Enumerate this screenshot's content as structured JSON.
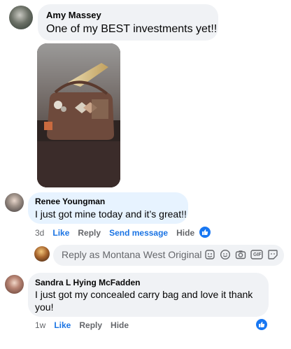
{
  "comments": [
    {
      "author": "Amy Massey",
      "text": "One of my BEST investments yet!!"
    },
    {
      "author": "Renee Youngman",
      "text": "I just got mine today and it’s great!!",
      "time": "3d",
      "like_label": "Like",
      "reply_label": "Reply",
      "send_message_label": "Send message",
      "hide_label": "Hide"
    },
    {
      "author": "Sandra L Hying McFadden",
      "text_line1": "I just got my concealed carry bag and love it thank",
      "text_line2": "you!",
      "time": "1w",
      "like_label": "Like",
      "reply_label": "Reply",
      "hide_label": "Hide"
    }
  ],
  "reply_box": {
    "placeholder": "Reply as Montana West Original",
    "gif_label": "GIF"
  },
  "colors": {
    "bubble_bg": "#f0f2f5",
    "highlight_bubble_bg": "#e7f3ff",
    "link_blue": "#1b74e4",
    "like_badge": "#1877f2",
    "meta_gray": "#65676b"
  },
  "icons": [
    "like-thumb-icon",
    "sticker-icon",
    "emoji-icon",
    "camera-icon",
    "gif-icon",
    "avatar-sticker-icon"
  ]
}
